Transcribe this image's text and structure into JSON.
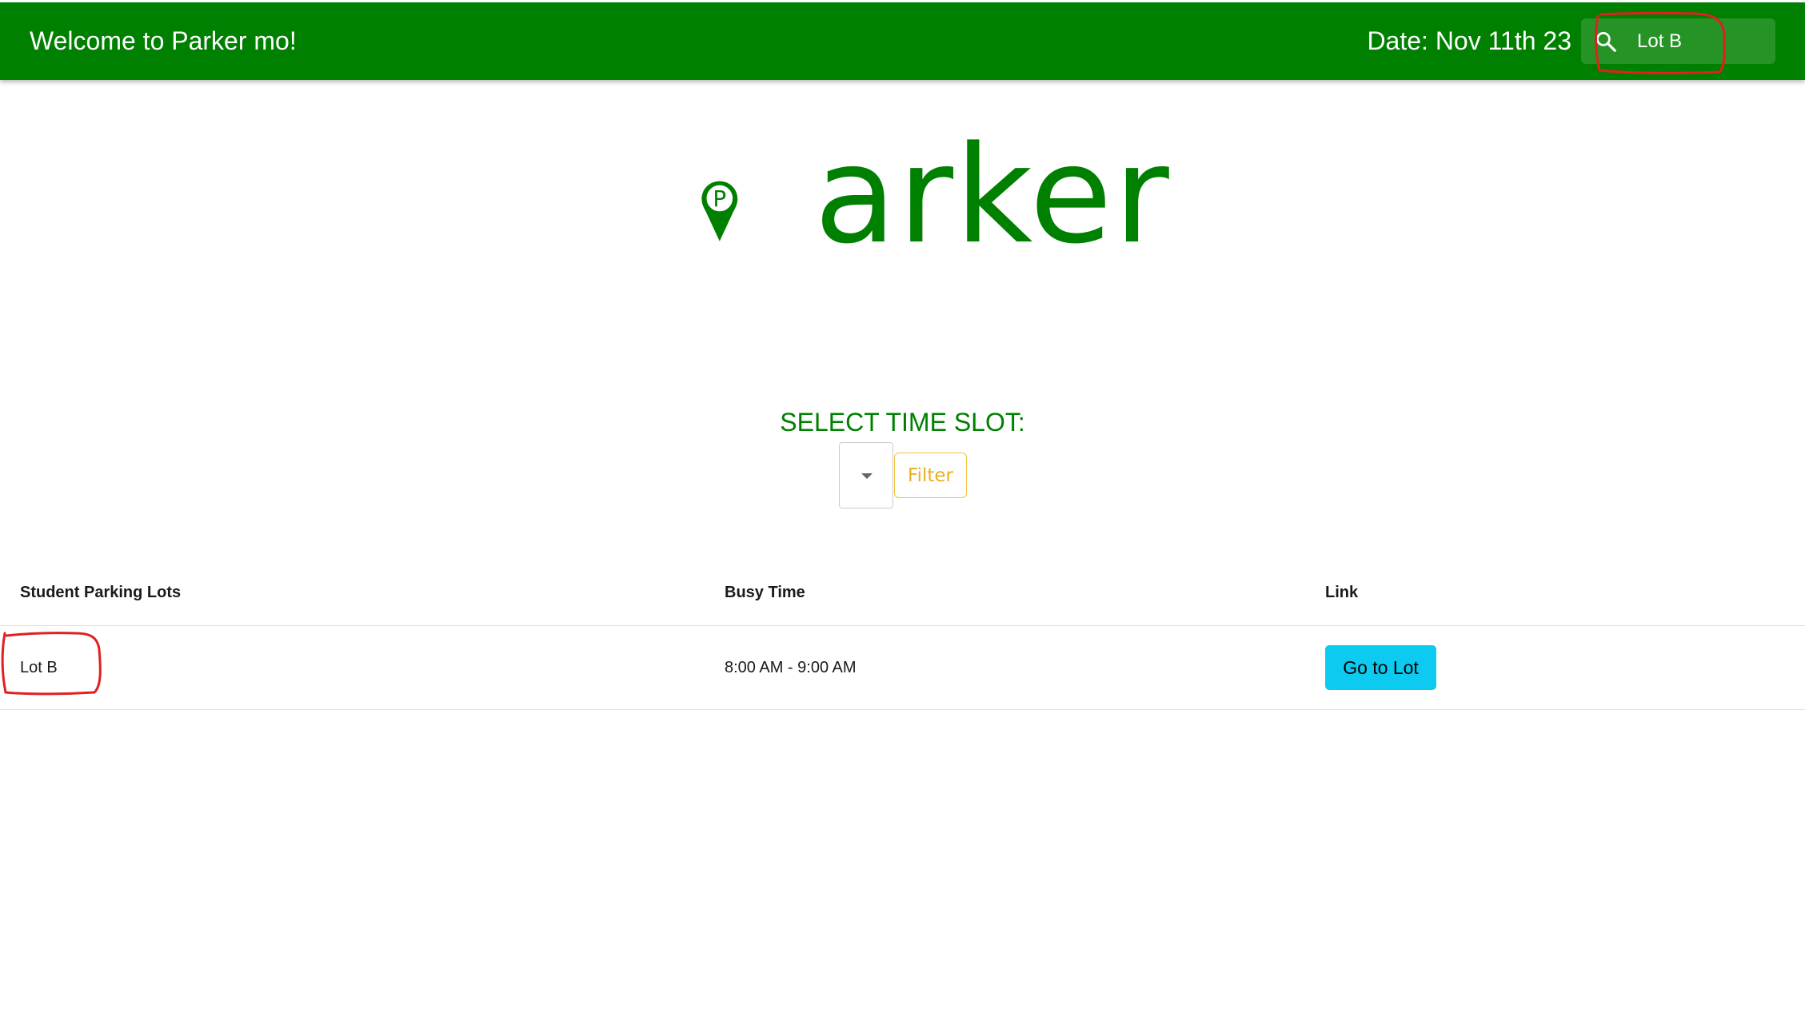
{
  "header": {
    "title": "Welcome to Parker mo!",
    "date": "Date: Nov 11th 23",
    "search": {
      "value": "Lot B",
      "icon": "search-icon"
    }
  },
  "logo": {
    "letter": "P",
    "text": "arker"
  },
  "time_slot": {
    "label": "SELECT TIME SLOT:",
    "selected": "",
    "filter_label": "Filter"
  },
  "table": {
    "columns": [
      "Student Parking Lots",
      "Busy Time",
      "Link"
    ],
    "rows": [
      {
        "lot": "Lot B",
        "busy_time": "8:00 AM - 9:00 AM",
        "link_label": "Go to Lot"
      }
    ]
  },
  "colors": {
    "brand_green": "#008000",
    "filter_yellow": "#e8b020",
    "button_cyan": "#0dcaf0",
    "annotation_red": "#e02020"
  }
}
